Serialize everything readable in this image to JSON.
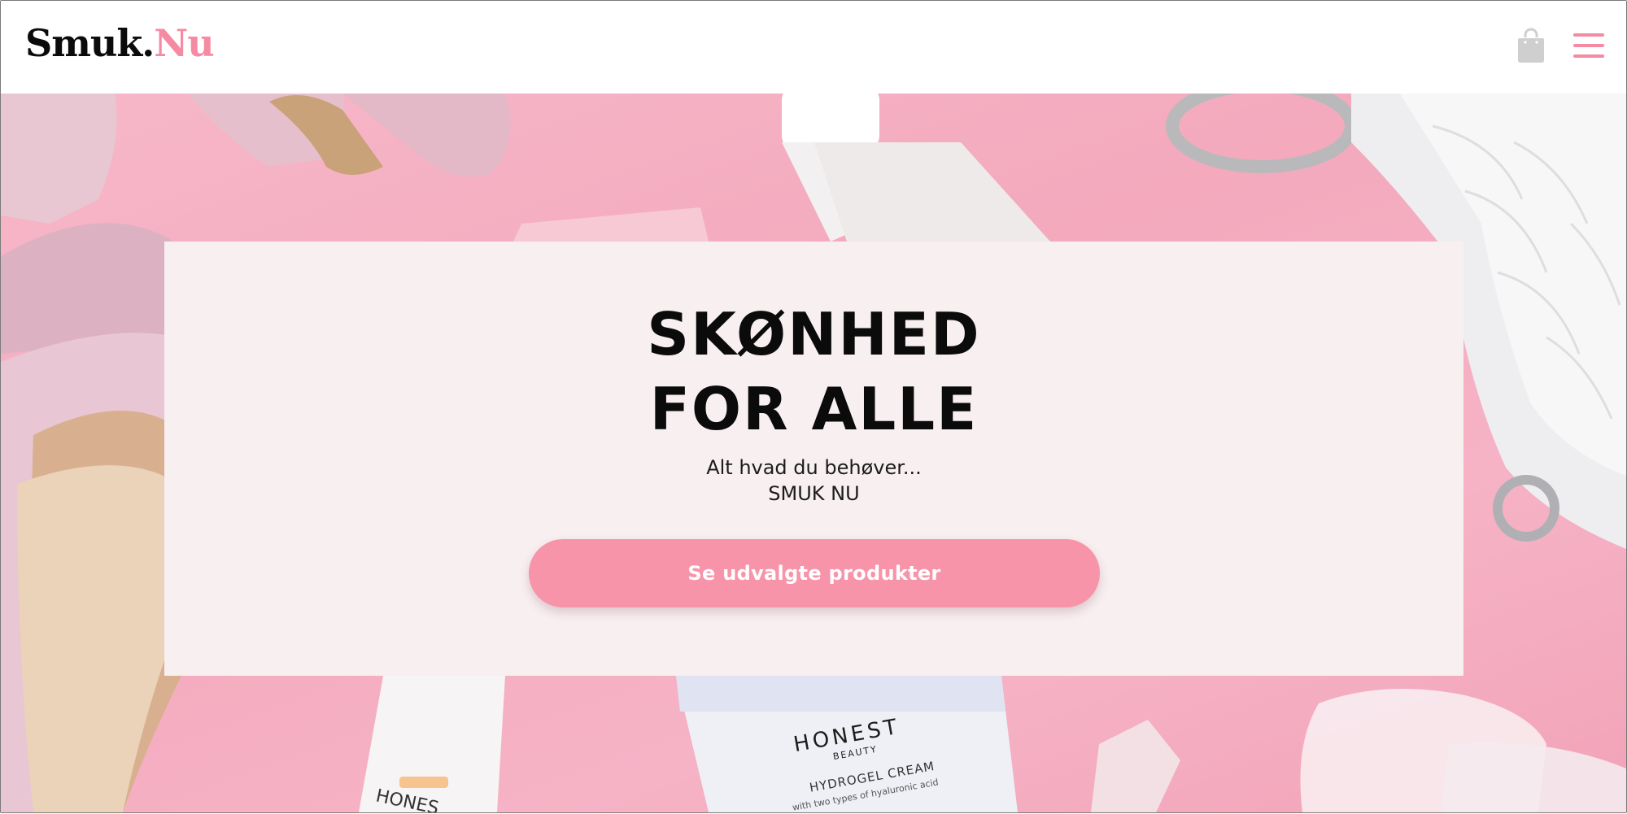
{
  "header": {
    "logo_part1": "Smuk.",
    "logo_part2": "Nu",
    "cart_icon": "shopping-bag-icon",
    "menu_icon": "hamburger-menu-icon"
  },
  "hero": {
    "headline_line1": "SKØNHED",
    "headline_line2": "FOR ALLE",
    "tagline_line1": "Alt hvad du behøver...",
    "tagline_line2": "SMUK NU",
    "cta_label": "Se udvalgte produkter",
    "product_jar_brand": "HONEST",
    "product_jar_sub": "BEAUTY",
    "product_jar_name": "HYDROGEL CREAM",
    "product_jar_desc": "with two types of hyaluronic acid",
    "product_stick_brand": "HONES"
  },
  "colors": {
    "accent_pink": "#f794a9",
    "logo_pink": "#f58aa3",
    "hero_background": "#f4a9bd",
    "card_background": "#f8eff1",
    "text_dark": "#0b0b0b"
  }
}
